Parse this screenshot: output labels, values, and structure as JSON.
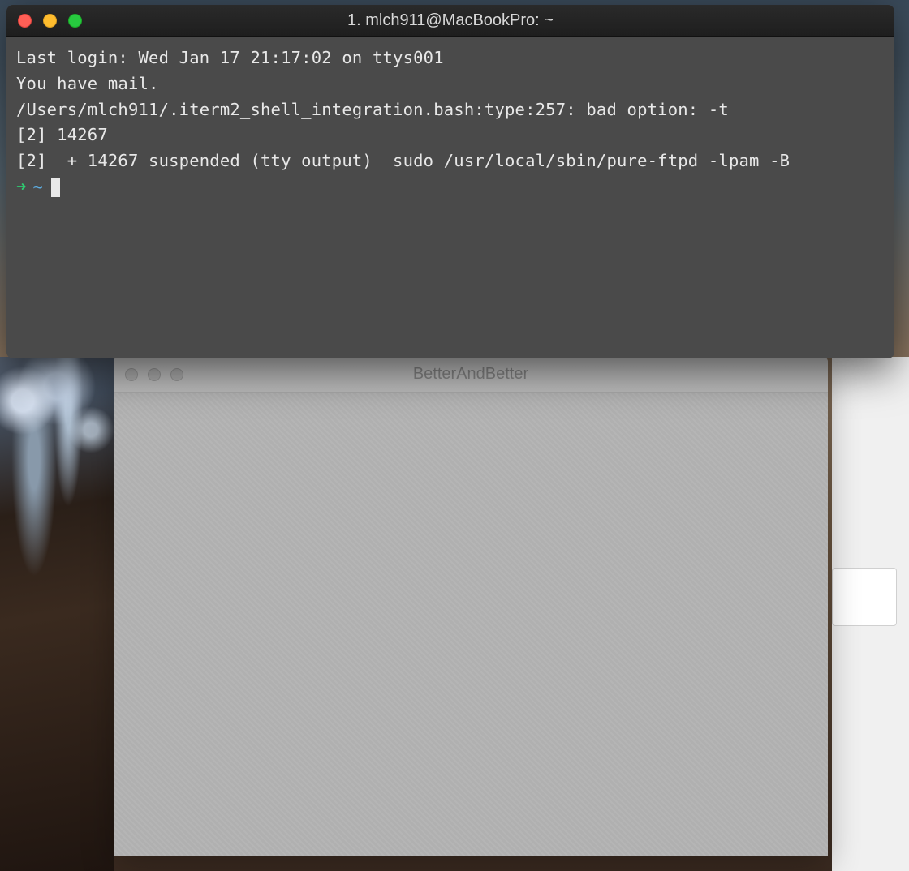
{
  "terminal": {
    "title": "1. mlch911@MacBookPro: ~",
    "lines": [
      "Last login: Wed Jan 17 21:17:02 on ttys001",
      "You have mail.",
      "/Users/mlch911/.iterm2_shell_integration.bash:type:257: bad option: -t",
      "[2] 14267",
      "[2]  + 14267 suspended (tty output)  sudo /usr/local/sbin/pure-ftpd -lpam -B"
    ],
    "prompt": {
      "arrow": "➜",
      "path": "~"
    }
  },
  "better": {
    "title": "BetterAndBetter"
  }
}
